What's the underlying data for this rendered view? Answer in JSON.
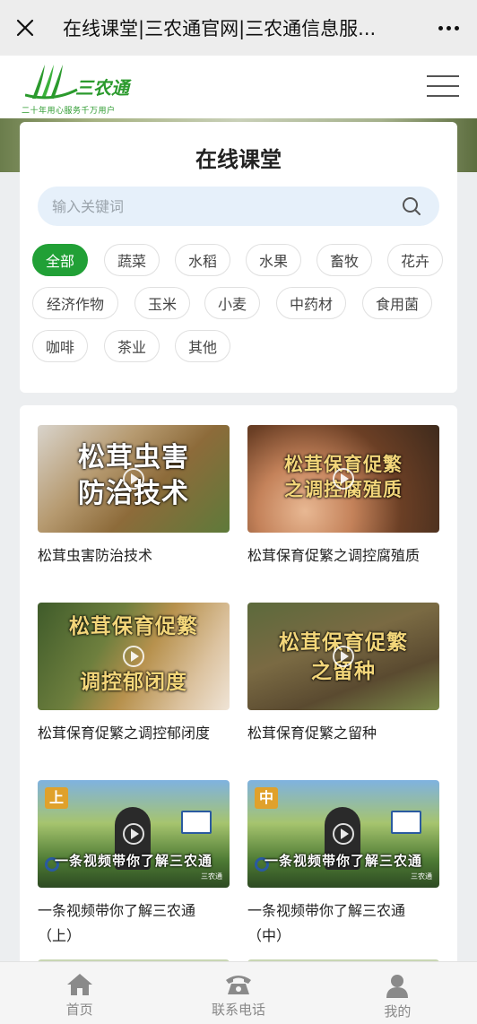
{
  "topbar": {
    "title": "在线课堂|三农通官网|三农通信息服..."
  },
  "site": {
    "brand": "三农通",
    "tagline": "二十年用心服务千万用户"
  },
  "course": {
    "title": "在线课堂",
    "search_placeholder": "输入关键词",
    "tags": [
      "全部",
      "蔬菜",
      "水稻",
      "水果",
      "畜牧",
      "花卉",
      "经济作物",
      "玉米",
      "小麦",
      "中药材",
      "食用菌",
      "咖啡",
      "茶业",
      "其他"
    ],
    "active_tag": "全部"
  },
  "videos": [
    {
      "title": "松茸虫害防治技术",
      "caption_lines": [
        "松茸虫害",
        "防治技术"
      ]
    },
    {
      "title": "松茸保育促繁之调控腐殖质",
      "caption_lines": [
        "松茸保育促繁",
        "之调控腐殖质"
      ]
    },
    {
      "title": "松茸保育促繁之调控郁闭度",
      "caption_lines": [
        "松茸保育促繁",
        "调控郁闭度"
      ]
    },
    {
      "title": "松茸保育促繁之留种",
      "caption_lines": [
        "松茸保育促繁",
        "之留种"
      ]
    },
    {
      "title": "一条视频带你了解三农通（上）",
      "caption_lines": [
        "一条视频带你了解三农通"
      ],
      "badge": "上",
      "credit": "三农通"
    },
    {
      "title": "一条视频带你了解三农通（中）",
      "caption_lines": [
        "一条视频带你了解三农通"
      ],
      "badge": "中",
      "credit": "三农通"
    }
  ],
  "bottom_nav": [
    {
      "label": "首页",
      "icon": "home-icon"
    },
    {
      "label": "联系电话",
      "icon": "phone-icon"
    },
    {
      "label": "我的",
      "icon": "user-icon"
    }
  ],
  "colors": {
    "accent": "#21a036",
    "brand": "#2b9a2d"
  }
}
